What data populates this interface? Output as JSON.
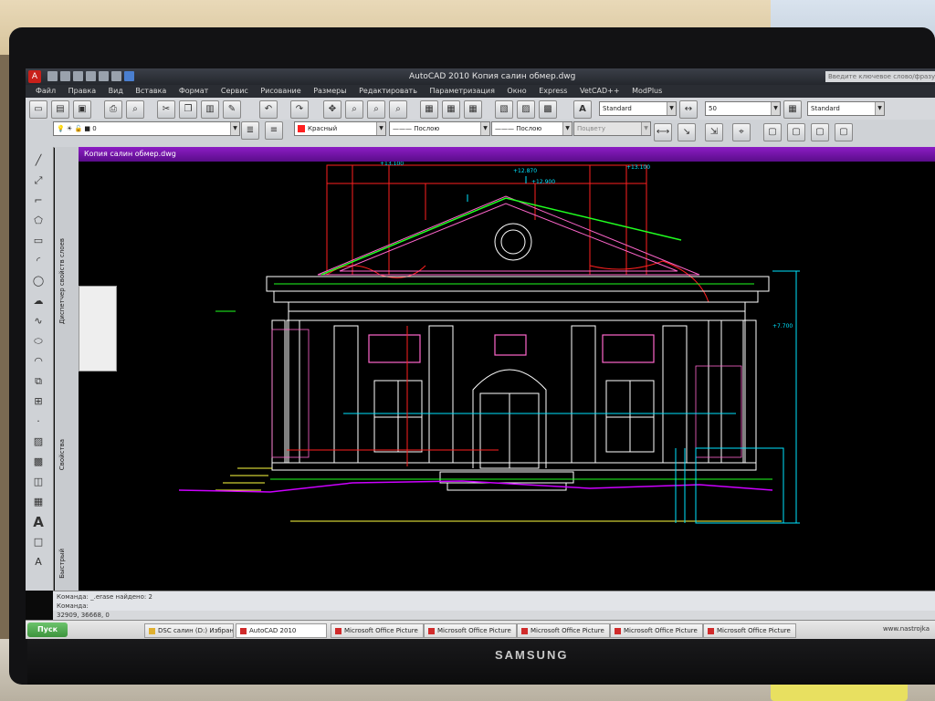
{
  "app": {
    "title": "AutoCAD 2010   Копия  салин обмер.dwg",
    "search_placeholder": "Введите ключевое слово/фразу"
  },
  "menu": [
    "Файл",
    "Правка",
    "Вид",
    "Вставка",
    "Формат",
    "Сервис",
    "Рисование",
    "Размеры",
    "Редактировать",
    "Параметризация",
    "Окно",
    "Express",
    "VetCAD++",
    "ModPlus"
  ],
  "toolbar": {
    "text_style": "Standard",
    "dim_scale": "50",
    "table_style": "Standard",
    "layer": "0",
    "color": "Красный",
    "linetype": "Послою",
    "lineweight": "Послою",
    "plotstyle": "Поцвету"
  },
  "document": {
    "tab": "Копия  салин обмер.dwg"
  },
  "palette": {
    "design_center": "Диспетчер свойств слоев",
    "properties": "Свойства",
    "quick": "Быстрый"
  },
  "drawing_labels": [
    "+13.100",
    "+12.870",
    "+12.900",
    "+13.100",
    "+7.700"
  ],
  "command": {
    "line1": "Команда:  _.erase  найдено: 2",
    "line2": "Команда:"
  },
  "status": {
    "coords": "32909, 36668, 0"
  },
  "taskbar": {
    "start": "Пуск",
    "items": [
      "DSC салин (D:) Избранное",
      "AutoCAD 2010",
      "Microsoft Office Picture",
      "Microsoft Office Picture",
      "Microsoft Office Picture",
      "Microsoft Office Picture",
      "Microsoft Office Picture"
    ],
    "tray": "www.nastrojka"
  },
  "monitor": {
    "brand": "SAMSUNG"
  },
  "colors": {
    "background": "#000000",
    "facade": "#ffffff",
    "roof_red": "#ff2020",
    "pink": "#ff66cc",
    "cyan": "#00e5ff",
    "green": "#20ff20",
    "magenta": "#cc00ff",
    "yellow": "#ffff40"
  }
}
